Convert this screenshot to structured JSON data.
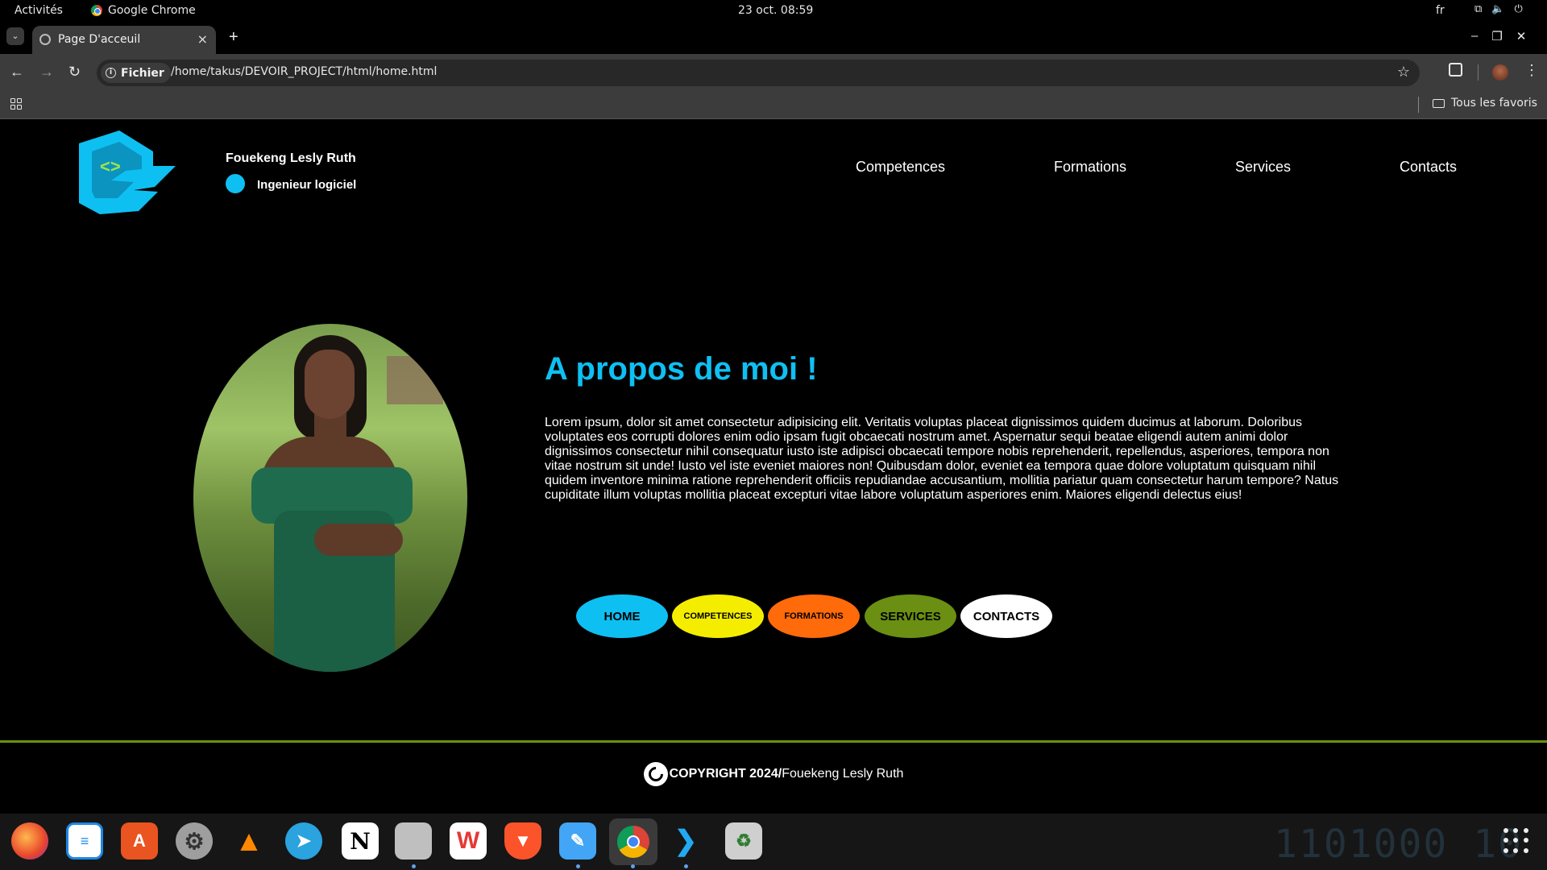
{
  "topbar": {
    "activities": "Activités",
    "app": "Google Chrome",
    "clock": "23 oct.  08:59",
    "lang": "fr",
    "icons": [
      "network-icon",
      "volume-icon",
      "power-icon"
    ]
  },
  "browser": {
    "tab_title": "Page D'acceuil",
    "new_tab": "+",
    "close_tab": "×",
    "security_chip": "Fichier",
    "url": "/home/takus/DEVOIR_PROJECT/html/home.html",
    "bookmarks_all": "Tous les favoris"
  },
  "site": {
    "name": "Fouekeng Lesly Ruth",
    "role": "Ingenieur logiciel",
    "logo_glyph": "<>",
    "nav": [
      "Competences",
      "Formations",
      "Services",
      "Contacts"
    ],
    "about_title": "A propos de moi !",
    "about_text": "Lorem ipsum, dolor sit amet consectetur adipisicing elit. Veritatis voluptas placeat dignissimos quidem ducimus at laborum. Doloribus voluptates eos corrupti dolores enim odio ipsam fugit obcaecati nostrum amet. Aspernatur sequi beatae eligendi autem animi dolor dignissimos consectetur nihil consequatur iusto iste adipisci obcaecati tempore nobis reprehenderit, repellendus, asperiores, tempora non vitae nostrum sit unde! Iusto vel iste eveniet maiores non! Quibusdam dolor, eveniet ea tempora quae dolore voluptatum quisquam nihil quidem inventore minima ratione reprehenderit officiis repudiandae accusantium, mollitia pariatur quam consectetur harum tempore? Natus cupiditate illum voluptas mollitia placeat excepturi vitae labore voluptatum asperiores enim. Maiores eligendi delectus eius!",
    "buttons": [
      {
        "label": "HOME",
        "color": "#0ec0f2"
      },
      {
        "label": "COMPETENCES",
        "color": "#f5ed00"
      },
      {
        "label": "FORMATIONS",
        "color": "#ff6a0a"
      },
      {
        "label": "SERVICES",
        "color": "#6a8f12"
      },
      {
        "label": "CONTACTS",
        "color": "#ffffff"
      }
    ],
    "footer_bold": "COPYRIGHT 2024/",
    "footer_name": "Fouekeng Lesly Ruth",
    "accent": "#0ec0f2",
    "footer_line_color": "#6a8f12"
  },
  "dock": {
    "apps": [
      "firefox-icon",
      "writer-icon",
      "app-center-icon",
      "settings-icon",
      "vlc-icon",
      "telegram-icon",
      "notion-icon",
      "files-icon",
      "wps-office-icon",
      "brave-icon",
      "text-editor-icon",
      "chrome-icon",
      "vscode-icon",
      "trash-icon"
    ],
    "wallpaper_text": "1101000  10"
  }
}
